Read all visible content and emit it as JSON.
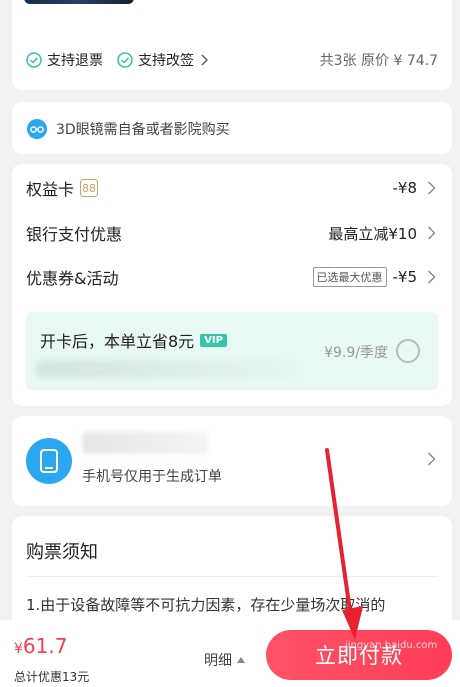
{
  "ticket_info": {
    "refund_label": "支持退票",
    "change_label": "支持改签",
    "summary": "共3张 原价 ¥ 74.7"
  },
  "glasses_note": "3D眼镜需自备或者影院购买",
  "benefits": {
    "card": {
      "label": "权益卡",
      "badge": "88",
      "value": "-¥8"
    },
    "bank": {
      "label": "银行支付优惠",
      "value": "最高立减¥10"
    },
    "coupon": {
      "label": "优惠券&活动",
      "tag": "已选最大优惠",
      "value": "-¥5"
    },
    "promo": {
      "title": "开卡后，本单立省8元",
      "vip": "VIP",
      "price": "¥9.9/季度"
    }
  },
  "phone": {
    "note": "手机号仅用于生成订单"
  },
  "notice": {
    "title": "购票须知",
    "text": "1.由于设备故障等不可抗力因素，存在少量场次取消的"
  },
  "footer": {
    "currency": "¥",
    "price": "61.7",
    "discount": "总计优惠13元",
    "detail_label": "明细",
    "pay_label": "立即付款"
  },
  "watermark": "jingyan.baidu.com",
  "colors": {
    "accent": "#ff3d57",
    "brand_green": "#35c5a8",
    "info_blue": "#2aa7f0"
  }
}
